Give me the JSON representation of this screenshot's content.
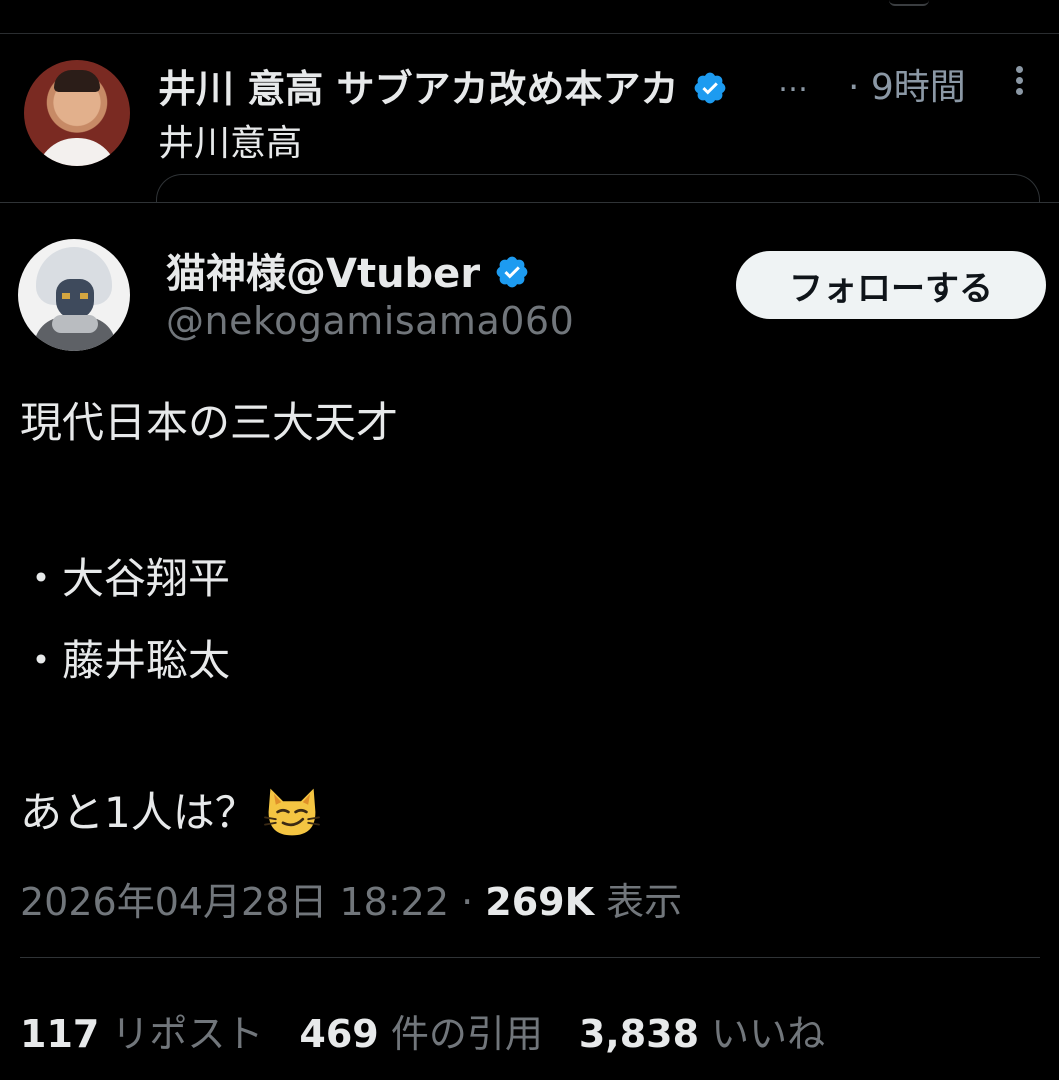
{
  "reply": {
    "author_name": "井川 意高 サブアカ改め本アカ",
    "ellipsis": "…",
    "time": "· 9時間",
    "text": "井川意高"
  },
  "tweet": {
    "author_name": "猫神様@Vtuber",
    "handle": "@nekogamisama060",
    "follow_label": "フォローする",
    "lines": [
      "現代日本の三大天才",
      "・大谷翔平",
      "・藤井聡太",
      "あと1人は？"
    ],
    "emoji": "cat-smirk-icon",
    "timestamp": "2026年04月28日 18:22 · ",
    "views_count": "269K",
    "views_label": " 表示",
    "stats": {
      "reposts_count": "117",
      "reposts_label": " リポスト",
      "quotes_count": "469",
      "quotes_label": " 件の引用",
      "likes_count": "3,838",
      "likes_label": " いいね"
    }
  },
  "colors": {
    "background": "#000000",
    "text_primary": "#e7e9ea",
    "text_secondary": "#71767b",
    "verified_blue": "#1d9bf0",
    "button_bg": "#eff3f4"
  }
}
